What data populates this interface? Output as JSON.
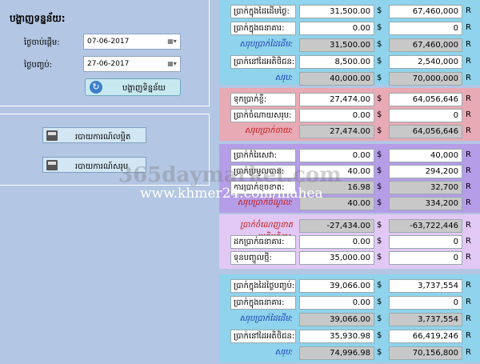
{
  "filter": {
    "title": "បង្ហាញទន្នន័យ:",
    "start_label": "ថ្ងៃចាប់ផ្តើម:",
    "start_value": "07-06-2017",
    "end_label": "ថ្ងៃបញ្ចប់:",
    "end_value": "27-06-2017",
    "apply_label": "បង្ហាញទិន្នន័យ"
  },
  "reports": {
    "detail_label": "របាយការណ៍លម្អិត",
    "summary_label": "របាយការណ៍សរុប"
  },
  "watermark": {
    "line1": "365daymarket.com",
    "line2": "www.khmer24.com/mahea"
  },
  "sections": [
    {
      "bg": "#8fd3ec",
      "rows": [
        {
          "label": "ប្រាក់ក្នុងដៃដើមថ្ងៃ:",
          "style": "normal",
          "v1": "31,500.00",
          "c1": "$",
          "v2": "67,460,000",
          "c2": "R",
          "gray": false
        },
        {
          "label": "ប្រាក់ក្នុងធនាគារ:",
          "style": "normal",
          "v1": "0.00",
          "c1": "$",
          "v2": "0",
          "c2": "R",
          "gray": false
        },
        {
          "label": "សរុបប្រាក់ដៃដើម:",
          "style": "blue",
          "v1": "31,500.00",
          "c1": "$",
          "v2": "67,460,000",
          "c2": "R",
          "gray": true
        },
        {
          "label": "ប្រាក់នៅដៃអតិថិជន:",
          "style": "normal",
          "v1": "8,500.00",
          "c1": "$",
          "v2": "2,540,000",
          "c2": "R",
          "gray": false
        },
        {
          "label": "សរុប:",
          "style": "blue",
          "v1": "40,000.00",
          "c1": "$",
          "v2": "70,000,000",
          "c2": "R",
          "gray": true
        }
      ]
    },
    {
      "bg": "#e8aab4",
      "rows": [
        {
          "label": "ទុកប្រាក់ខ្ចី:",
          "style": "normal",
          "v1": "27,474.00",
          "c1": "$",
          "v2": "64,056,646",
          "c2": "R",
          "gray": false
        },
        {
          "label": "ប្រាក់ចំណាយសរុប:",
          "style": "normal",
          "v1": "0.00",
          "c1": "$",
          "v2": "0",
          "c2": "R",
          "gray": false
        },
        {
          "label": "សរុបប្រាក់ចាយ:",
          "style": "red",
          "v1": "27,474.00",
          "c1": "$",
          "v2": "64,056,646",
          "c2": "R",
          "gray": true
        }
      ]
    },
    {
      "bg": "#b59de8",
      "rows": [
        {
          "label": "ប្រាក់កំរៃសេវា:",
          "style": "normal",
          "v1": "0.00",
          "c1": "$",
          "v2": "40,000",
          "c2": "R",
          "gray": false
        },
        {
          "label": "ប្រាក់ប្រមូលបាន:",
          "style": "normal",
          "v1": "40.00",
          "c1": "$",
          "v2": "294,200",
          "c2": "R",
          "gray": false
        },
        {
          "label": "ការប្រាក់ខូចខាត:",
          "style": "normal",
          "v1": "16.98",
          "c1": "$",
          "v2": "32,700",
          "c2": "R",
          "gray": true
        },
        {
          "label": "សរុបប្រាក់ចំណូល:",
          "style": "red",
          "v1": "40.00",
          "c1": "$",
          "v2": "334,200",
          "c2": "R",
          "gray": true
        }
      ]
    },
    {
      "bg": "#e2c8f4",
      "rows": [
        {
          "label": "ប្រាក់ចំណេញខាតប្រតិបត្តិការ:",
          "style": "red",
          "v1": "-27,434.00",
          "c1": "$",
          "v2": "-63,722,446",
          "c2": "R",
          "gray": true
        },
        {
          "label": "ដកប្រាក់ធនាគារ:",
          "style": "normal",
          "v1": "0.00",
          "c1": "$",
          "v2": "0",
          "c2": "R",
          "gray": false
        },
        {
          "label": "ទុនបញ្ចូលថ្មី:",
          "style": "normal",
          "v1": "35,000.00",
          "c1": "$",
          "v2": "0",
          "c2": "R",
          "gray": false
        }
      ]
    },
    {
      "bg": "#8fd3ec",
      "rows": [
        {
          "label": "ប្រាក់ក្នុងដៃថ្ងៃបញ្ចប់:",
          "style": "normal",
          "v1": "39,066.00",
          "c1": "$",
          "v2": "3,737,554",
          "c2": "R",
          "gray": false
        },
        {
          "label": "ប្រាក់ក្នុងធនាគារ:",
          "style": "normal",
          "v1": "0.00",
          "c1": "$",
          "v2": "0",
          "c2": "R",
          "gray": false
        },
        {
          "label": "សរុបប្រាក់ដៃដើម:",
          "style": "blue",
          "v1": "39,066.00",
          "c1": "$",
          "v2": "3,737,554",
          "c2": "R",
          "gray": true
        },
        {
          "label": "ប្រាក់នៅដៃអតិថិជន:",
          "style": "normal",
          "v1": "35,930.98",
          "c1": "$",
          "v2": "66,419,246",
          "c2": "R",
          "gray": false
        },
        {
          "label": "សរុប:",
          "style": "blue",
          "v1": "74,996.98",
          "c1": "$",
          "v2": "70,156,800",
          "c2": "R",
          "gray": true
        }
      ]
    }
  ]
}
